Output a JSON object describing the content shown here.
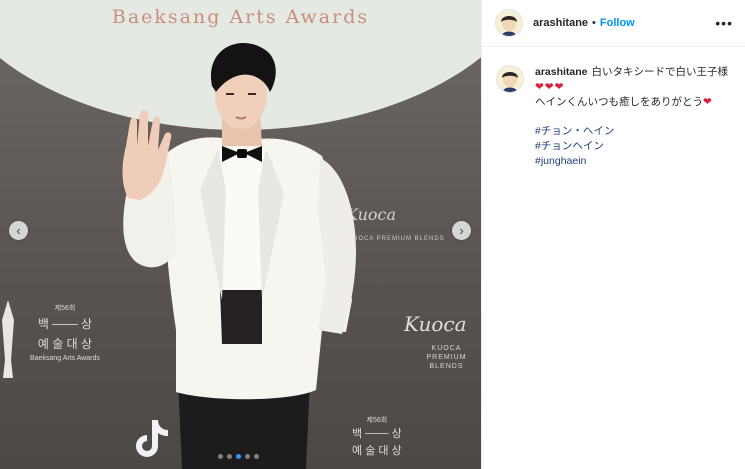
{
  "post": {
    "banner_text": "Baeksang Arts Awards",
    "signage": {
      "kuoca_mid": "Kuoca",
      "kuoca_mid_sub": "KUOCA PREMIUM BLENDS",
      "kuoca_right": "Kuoca",
      "kuoca_right_sub_1": "KUOCA",
      "kuoca_right_sub_2": "PREMIUM BLENDS",
      "left_edition": "제56회",
      "left_line1": "백 ─── 상",
      "left_line2": "예 술 대 상",
      "left_english": "Baeksang Arts Awards",
      "bottom_edition": "제56회",
      "bottom_line1": "백 ─── 상",
      "bottom_line2": "예 술 대 상"
    },
    "carousel": {
      "prev_icon": "chevron-left-icon",
      "next_icon": "chevron-right-icon",
      "count": 5,
      "active_index": 2
    }
  },
  "header": {
    "username": "arashitane",
    "separator": "•",
    "follow_label": "Follow",
    "more_icon": "more-options-icon",
    "more_label": "•••"
  },
  "caption": {
    "username": "arashitane",
    "line1": "白いタキシードで白い王子様",
    "hearts1": "❤❤❤",
    "line2": "ヘインくんいつも癒しをありがとう",
    "hearts2": "❤",
    "hashtags": [
      "#チョン・ヘイン",
      "#チョンヘイン",
      "#junghaein"
    ]
  },
  "colors": {
    "link": "#0095f6",
    "hashtag": "#1e3d7a",
    "banner": "#c98f7d",
    "heart": "#d8233c"
  }
}
